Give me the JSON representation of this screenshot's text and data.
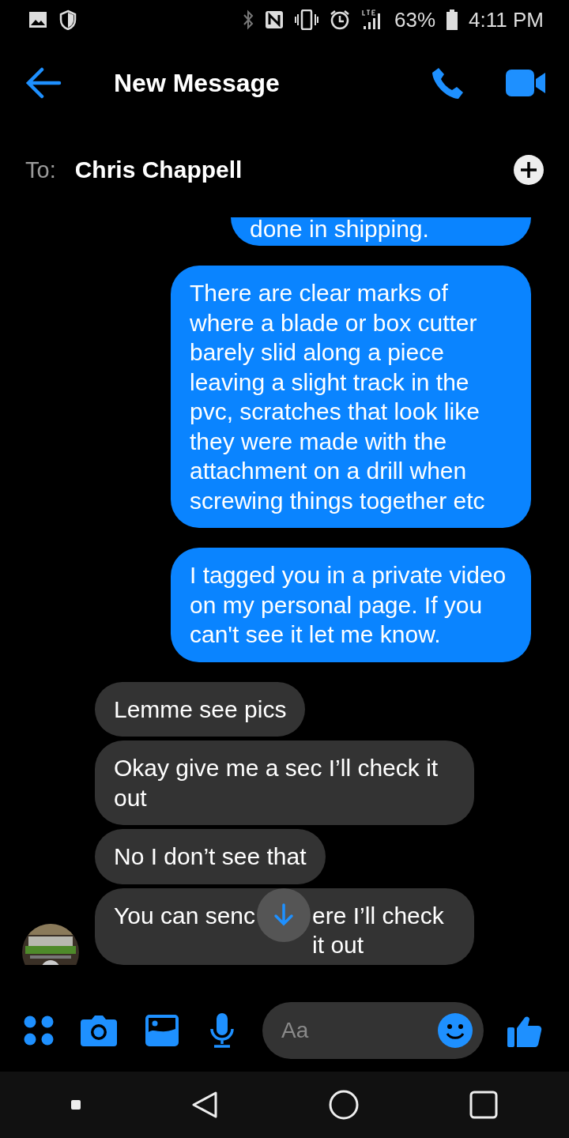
{
  "status_bar": {
    "battery": "63%",
    "time": "4:11 PM"
  },
  "header": {
    "title": "New Message"
  },
  "recipient": {
    "label": "To:",
    "name": "Chris Chappell"
  },
  "messages": [
    {
      "kind": "sent",
      "parts": [
        "done in shipping."
      ],
      "cut": true
    },
    {
      "kind": "sent",
      "parts": [
        "There are clear marks of where a blade or box cutter barely slid along a piece leaving a slight track in the pvc, scratches that look like they were made with the attachment on a drill when screwing things together etc"
      ]
    },
    {
      "kind": "sent",
      "parts": [
        "I tagged you in a private video on my personal page. If you can't see it let me know."
      ]
    },
    {
      "kind": "received",
      "parts": [
        "Lemme see pics"
      ]
    },
    {
      "kind": "received",
      "parts": [
        "Okay give me a sec I’ll check it out"
      ]
    },
    {
      "kind": "received",
      "parts": [
        "No I don’t see that"
      ]
    },
    {
      "kind": "received",
      "parts": [
        "You can senc",
        "ere I’ll check it out"
      ],
      "avatar": true
    }
  ],
  "composer": {
    "placeholder": "Aa"
  }
}
